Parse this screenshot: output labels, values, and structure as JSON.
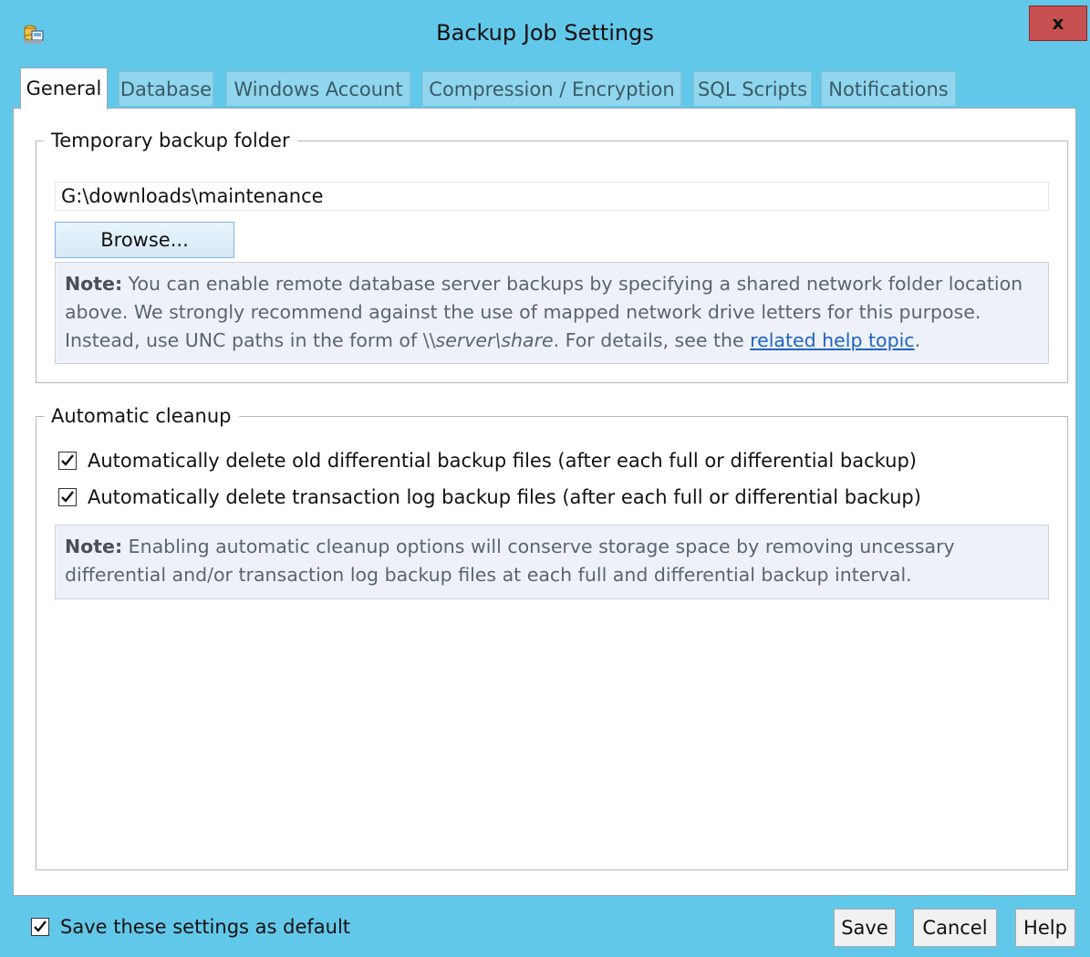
{
  "window": {
    "title": "Backup Job Settings",
    "close_label": "x"
  },
  "tabs": [
    {
      "label": "General",
      "active": true
    },
    {
      "label": "Database",
      "active": false
    },
    {
      "label": "Windows Account",
      "active": false
    },
    {
      "label": "Compression / Encryption",
      "active": false
    },
    {
      "label": "SQL Scripts",
      "active": false
    },
    {
      "label": "Notifications",
      "active": false
    }
  ],
  "temp_folder": {
    "legend": "Temporary backup folder",
    "path_value": "G:\\downloads\\maintenance",
    "browse_label": "Browse...",
    "note_bold": "Note:",
    "note_text_1": " You can enable remote database server backups by specifying a shared network folder location above. We strongly recommend against the use of mapped network drive letters for this purpose. Instead, use UNC paths in the form of ",
    "note_unc_prefix": "\\\\",
    "note_unc_server": "server",
    "note_unc_sep": "\\",
    "note_unc_share": "share",
    "note_text_2": ". For details, see the ",
    "note_link": "related help topic",
    "note_text_3": "."
  },
  "cleanup": {
    "legend": "Automatic cleanup",
    "options": [
      {
        "label": "Automatically delete old differential backup files (after each full or differential backup)",
        "checked": true
      },
      {
        "label": "Automatically delete transaction log backup files (after each full or differential backup)",
        "checked": true
      }
    ],
    "note_bold": "Note:",
    "note_text": " Enabling automatic cleanup options will conserve storage space by removing uncessary differential and/or transaction log backup files at each full and differential backup interval."
  },
  "footer": {
    "default_label": "Save these settings as default",
    "default_checked": true,
    "save_label": "Save",
    "cancel_label": "Cancel",
    "help_label": "Help"
  },
  "colors": {
    "titlebar": "#62c8ea",
    "close_button": "#c75050",
    "link": "#1f63c4",
    "note_background": "#eef2f8"
  }
}
